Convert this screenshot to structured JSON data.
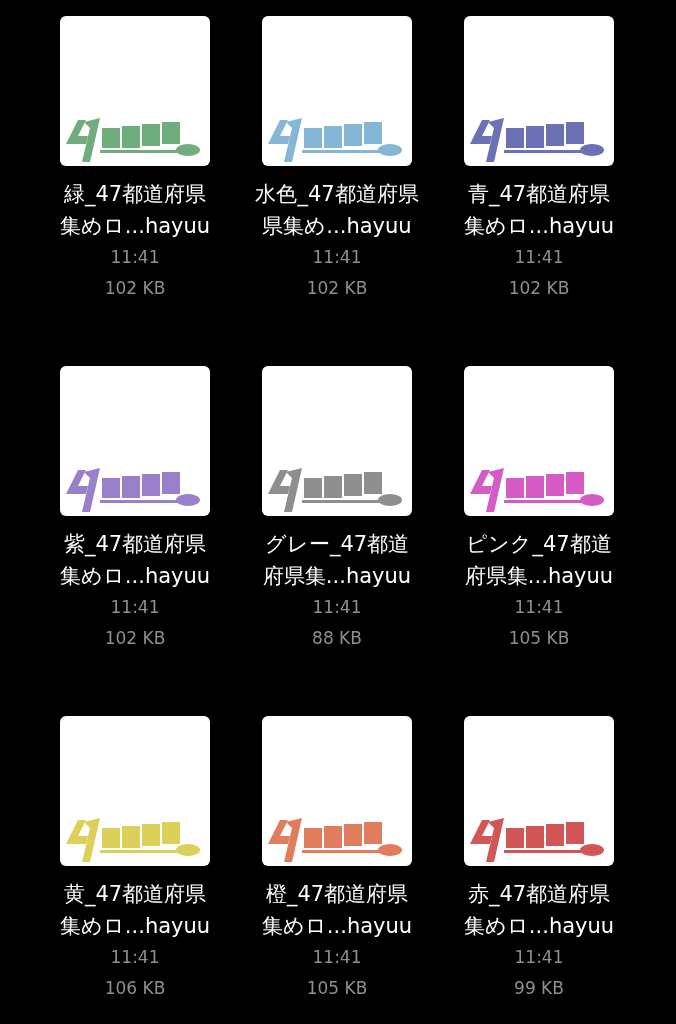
{
  "files": [
    {
      "name": [
        "緑_47都道府県",
        "集めロ...hayuu"
      ],
      "time": "11:41",
      "size": "102 KB",
      "color": "#6fae7c"
    },
    {
      "name": [
        "水色_47都道府県",
        "県集め...hayuu"
      ],
      "time": "11:41",
      "size": "102 KB",
      "color": "#86b6d6"
    },
    {
      "name": [
        "青_47都道府県",
        "集めロ...hayuu"
      ],
      "time": "11:41",
      "size": "102 KB",
      "color": "#6c70b4"
    },
    {
      "name": [
        "紫_47都道府県",
        "集めロ...hayuu"
      ],
      "time": "11:41",
      "size": "102 KB",
      "color": "#9a7fca"
    },
    {
      "name": [
        "グレー_47都道",
        "府県集...hayuu"
      ],
      "time": "11:41",
      "size": "88 KB",
      "color": "#8e8e8e"
    },
    {
      "name": [
        "ピンク_47都道",
        "府県集...hayuu"
      ],
      "time": "11:41",
      "size": "105 KB",
      "color": "#d45cc4"
    },
    {
      "name": [
        "黄_47都道府県",
        "集めロ...hayuu"
      ],
      "time": "11:41",
      "size": "106 KB",
      "color": "#dccf5a"
    },
    {
      "name": [
        "橙_47都道府県",
        "集めロ...hayuu"
      ],
      "time": "11:41",
      "size": "105 KB",
      "color": "#e07d5c"
    },
    {
      "name": [
        "赤_47都道府県",
        "集めロ...hayuu"
      ],
      "time": "11:41",
      "size": "99 KB",
      "color": "#d25656"
    }
  ]
}
